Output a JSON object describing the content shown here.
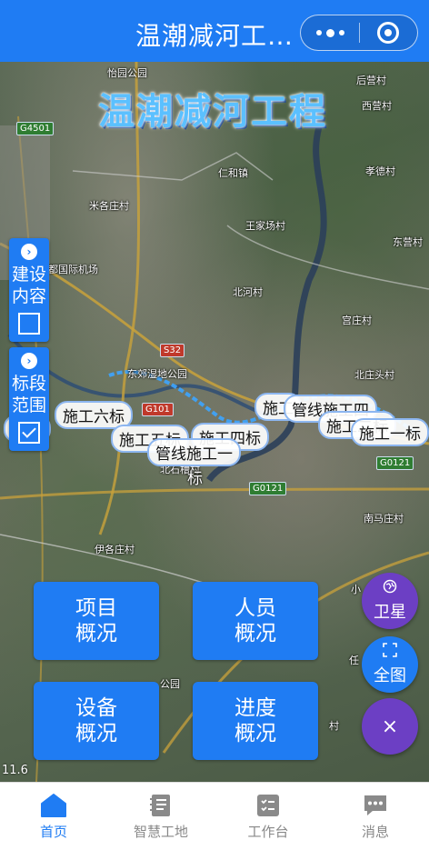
{
  "header": {
    "title": "温潮减河工…"
  },
  "map": {
    "overlay_title": "温潮减河工程",
    "places": [
      "怡园公园",
      "后营村",
      "西营村",
      "孝德村",
      "东营村",
      "米各庄村",
      "仁和镇",
      "王家场村",
      "北京首都国际机场",
      "北河村",
      "宫庄村",
      "东郊湿地公园",
      "北庄头村",
      "北石槽村",
      "南马庄村",
      "伊各庄村",
      "小",
      "任",
      "公园",
      "村"
    ],
    "shields": [
      "G4501",
      "S32",
      "G101",
      "G0121",
      "G0121"
    ],
    "scale": "11.6"
  },
  "side_panels": [
    {
      "label": "建设内容",
      "checked": false
    },
    {
      "label": "标段范围",
      "checked": true
    }
  ],
  "segments": [
    "七标",
    "施工六标",
    "施工五标",
    "施工四标",
    "管线施工一",
    "施工",
    "管线施工四",
    "施工二标",
    "施工一标",
    "标"
  ],
  "actions": [
    {
      "label": "项目概况"
    },
    {
      "label": "人员概况"
    },
    {
      "label": "设备概况"
    },
    {
      "label": "进度概况"
    }
  ],
  "fabs": [
    {
      "label": "卫星",
      "icon": "satellite-icon"
    },
    {
      "label": "全图",
      "icon": "fullscreen-icon"
    },
    {
      "label": "×",
      "icon": "close-icon"
    }
  ],
  "tabs": [
    {
      "label": "首页",
      "icon": "home-icon",
      "active": true
    },
    {
      "label": "智慧工地",
      "icon": "notebook-icon"
    },
    {
      "label": "工作台",
      "icon": "checklist-icon"
    },
    {
      "label": "消息",
      "icon": "message-icon"
    }
  ],
  "colors": {
    "primary": "#1f7cf3",
    "purple": "#6c3fc4"
  }
}
